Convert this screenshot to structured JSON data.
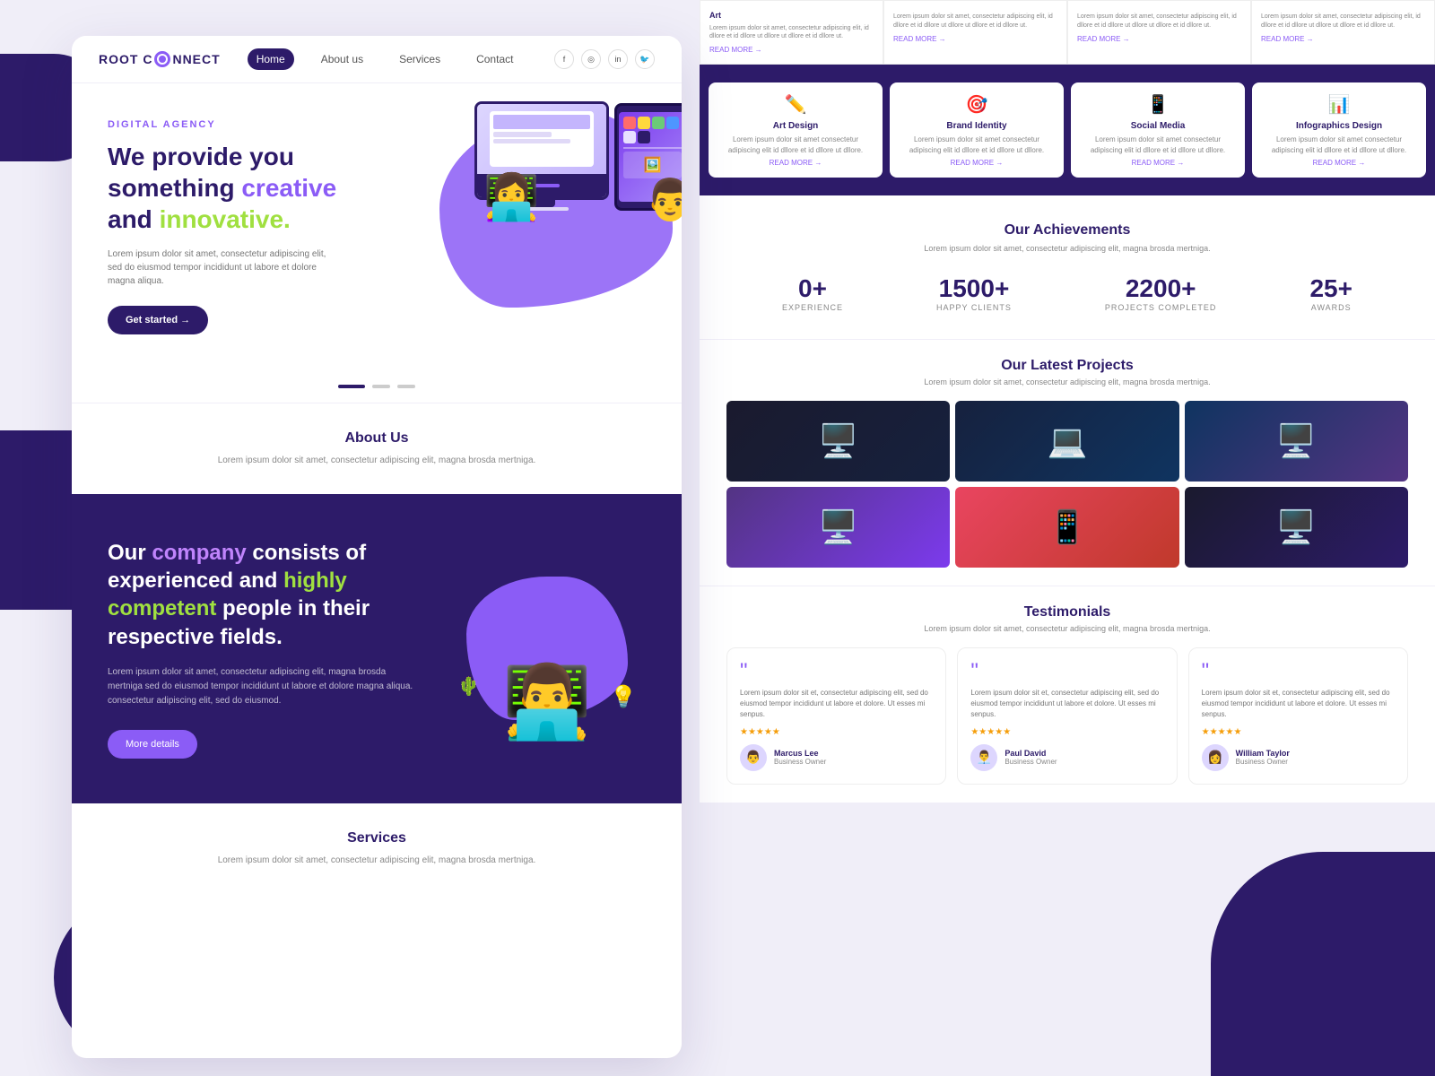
{
  "brand": {
    "logo_text_1": "ROOT C",
    "logo_text_2": "NNECT"
  },
  "nav": {
    "links": [
      "Home",
      "About us",
      "Services",
      "Contact"
    ],
    "active_index": 0
  },
  "hero": {
    "badge": "DIGITAL AGENCY",
    "title_1": "We provide you something ",
    "title_highlight_1": "creative",
    "title_2": " and ",
    "title_highlight_2": "innovative.",
    "description": "Lorem ipsum dolor sit amet, consectetur adipiscing elit, sed do eiusmod tempor incididunt ut labore et dolore magna aliqua.",
    "cta_button": "Get started →"
  },
  "pagination": {
    "dots": [
      "active",
      "inactive",
      "inactive"
    ]
  },
  "about": {
    "title": "About Us",
    "description": "Lorem ipsum dolor sit amet, consectetur adipiscing elit, magna brosda mertniga."
  },
  "company": {
    "title_1": "Our ",
    "title_highlight_1": "company",
    "title_2": " consists of experienced and ",
    "title_highlight_2": "highly competent",
    "title_3": " people in their respective fields.",
    "description": "Lorem ipsum dolor sit amet, consectetur adipiscing elit, magna brosda mertniga sed do eiusmod tempor incididunt ut labore et dolore magna aliqua. consectetur adipiscing elit, sed do eiusmod.",
    "button": "More details"
  },
  "services_bottom": {
    "title": "Services",
    "description": "Lorem ipsum dolor sit amet, consectetur adipiscing elit, magna brosda mertniga."
  },
  "top_cards": [
    {
      "text": "Lorem ipsum dolor sit amet, consectetur adipiscing elit, id dllore et id dllore ut dllore ut dllore et id dllore ut.",
      "read_more": "READ MORE →"
    },
    {
      "text": "Lorem ipsum dolor sit amet, consectetur adipiscing elit, id dllore et id dllore ut dllore ut dllore et id dllore ut.",
      "read_more": "READ MORE →"
    },
    {
      "text": "Lorem ipsum dolor sit amet, consectetur adipiscing elit, id dllore et id dllore ut dllore ut dllore et id dllore ut.",
      "read_more": "READ MORE →"
    },
    {
      "text": "Lorem ipsum dolor sit amet, consectetur adipiscing elit, id dllore et id dllore ut dllore ut dllore et id dllore ut.",
      "read_more": "READ MORE →"
    }
  ],
  "services": [
    {
      "name": "Art Design",
      "icon": "✏️",
      "description": "Lorem ipsum dolor sit amet consectetur adipiscing elit id dllore et id dllore ut dllore."
    },
    {
      "name": "Brand Identity",
      "icon": "🎯",
      "description": "Lorem ipsum dolor sit amet consectetur adipiscing elit id dllore et id dllore ut dllore."
    },
    {
      "name": "Social Media",
      "icon": "📱",
      "description": "Lorem ipsum dolor sit amet consectetur adipiscing elit id dllore et id dllore ut dllore."
    },
    {
      "name": "Infographics Design",
      "icon": "📊",
      "description": "Lorem ipsum dolor sit amet consectetur adipiscing elit id dllore et id dllore ut dllore."
    }
  ],
  "achievements": {
    "title": "Our Achievements",
    "description": "Lorem ipsum dolor sit amet, consectetur adipiscing elit, magna brosda mertniga.",
    "stats": [
      {
        "number": "0+",
        "label": "EXPERIENCE"
      },
      {
        "number": "1500+",
        "label": "HAPPY CLIENTS"
      },
      {
        "number": "2200+",
        "label": "PROJECTS COMPLETED"
      },
      {
        "number": "25+",
        "label": "AWARDS"
      }
    ]
  },
  "projects": {
    "title": "Our Latest Projects",
    "description": "Lorem ipsum dolor sit amet, consectetur adipiscing elit, magna brosda mertniga.",
    "items": [
      {
        "bg": "#1a1a2e",
        "icon": "🖥️"
      },
      {
        "bg": "#16213e",
        "icon": "💻"
      },
      {
        "bg": "#0f3460",
        "icon": "🖥️"
      },
      {
        "bg": "#533483",
        "icon": "🖥️"
      },
      {
        "bg": "#e94560",
        "icon": "📱"
      },
      {
        "bg": "#1a1a2e",
        "icon": "🖥️"
      }
    ]
  },
  "testimonials": {
    "title": "Testimonials",
    "description": "Lorem ipsum dolor sit amet, consectetur adipiscing elit, magna brosda mertniga.",
    "items": [
      {
        "text": "Lorem ipsum dolor sit et, consectetur adipiscing elit, sed do eiusmod tempor incididunt ut labore et dolore. Ut esses mi senpus.",
        "stars": "★★★★★",
        "name": "Marcus Lee",
        "role": "Business Owner",
        "avatar": "👨"
      },
      {
        "text": "Lorem ipsum dolor sit et, consectetur adipiscing elit, sed do eiusmod tempor incididunt ut labore et dolore. Ut esses mi senpus.",
        "stars": "★★★★★",
        "name": "Paul David",
        "role": "Business Owner",
        "avatar": "👨‍💼"
      },
      {
        "text": "Lorem ipsum dolor sit et, consectetur adipiscing elit, sed do eiusmod tempor incididunt ut labore et dolore. Ut esses mi senpus.",
        "stars": "★★★★★",
        "name": "William Taylor",
        "role": "Business Owner",
        "avatar": "👩"
      }
    ]
  }
}
